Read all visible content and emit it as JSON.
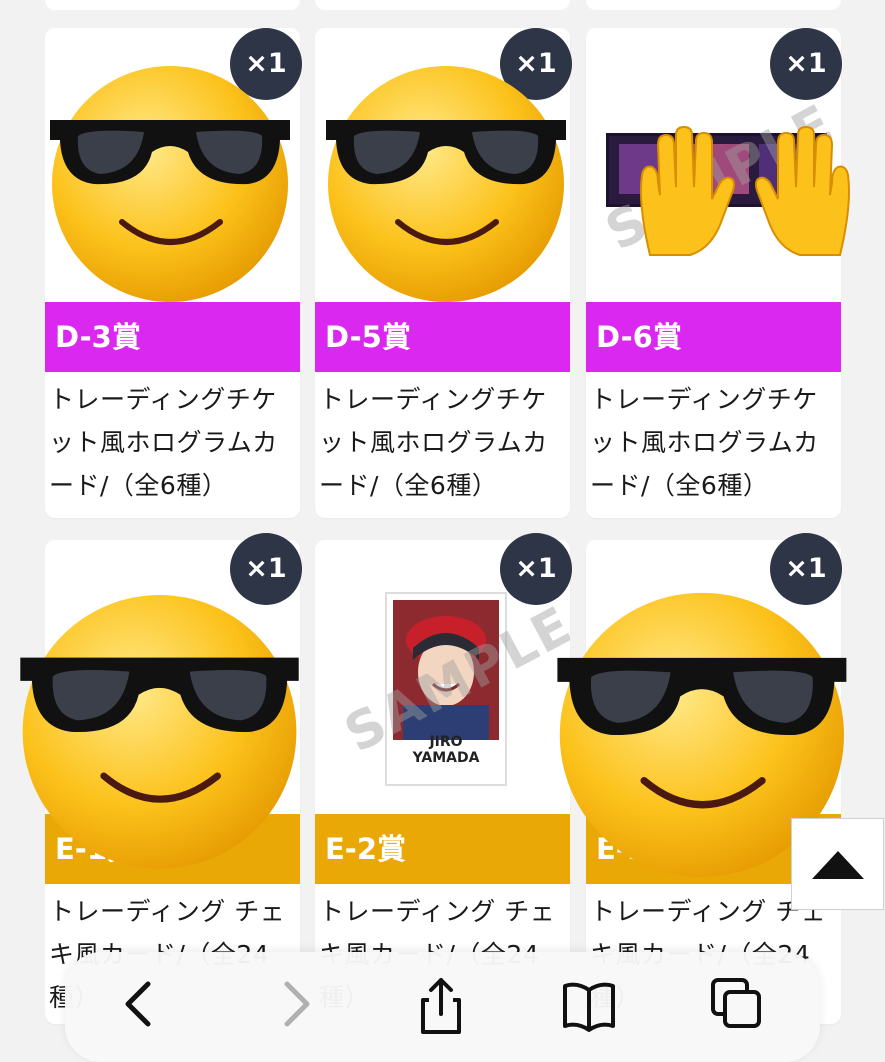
{
  "colors": {
    "purple_band": "#da28f0",
    "gold_band": "#e9a806",
    "badge": "#2e3547"
  },
  "cards": [
    {
      "badge": "×1",
      "prize": "D-3賞",
      "desc": "トレーディングチケット風ホログラムカード/（全6種）",
      "band_color": "#da28f0"
    },
    {
      "badge": "×1",
      "prize": "D-5賞",
      "desc": "トレーディングチケット風ホログラムカード/（全6種）",
      "band_color": "#da28f0"
    },
    {
      "badge": "×1",
      "prize": "D-6賞",
      "desc": "トレーディングチケット風ホログラムカード/（全6種）",
      "band_color": "#da28f0"
    },
    {
      "badge": "×1",
      "prize": "E-1賞",
      "desc": "トレーディング チェキ風カード/（全24種）",
      "band_color": "#e9a806"
    },
    {
      "badge": "×1",
      "prize": "E-2賞",
      "desc": "トレーディング チェキ風カード/（全24種）",
      "band_color": "#e9a806"
    },
    {
      "badge": "×1",
      "prize": "E-3賞",
      "desc": "トレーディング チェキ風カード/（全24種）",
      "band_color": "#e9a806"
    }
  ],
  "watermark": "SAMPLE",
  "photo_caption_line1": "JIRO",
  "photo_caption_line2": "YAMADA",
  "icons": {
    "scroll_top": "triangle-up-icon",
    "back": "chevron-left-icon",
    "forward": "chevron-right-icon",
    "share": "share-icon",
    "bookmarks": "book-icon",
    "tabs": "tabs-icon"
  }
}
